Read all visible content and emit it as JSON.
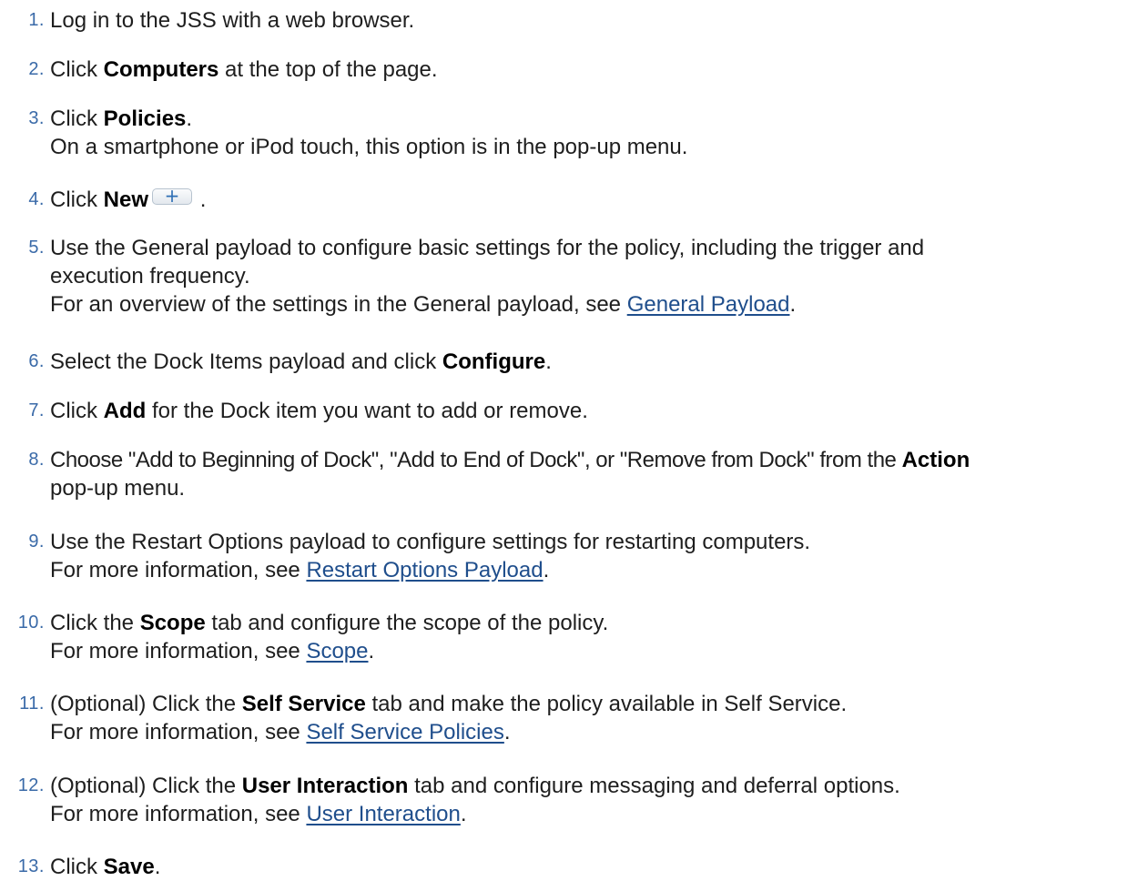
{
  "steps": [
    {
      "n": "1.",
      "pre": "Log in to the JSS with a web browser."
    },
    {
      "n": "2.",
      "pre": "Click ",
      "bold": "Computers",
      "post": " at the top of the page."
    },
    {
      "n": "3.",
      "pre": "Click ",
      "bold": "Policies",
      "post": ".",
      "note": "On a smartphone or iPod touch, this option is in the pop-up menu."
    },
    {
      "n": "4.",
      "pre": "Click ",
      "bold": "New",
      "post": " .",
      "button_icon": "plus-icon",
      "button_glyph": "+"
    },
    {
      "n": "5.",
      "pre": "Use the General payload to configure basic settings for the policy, including the trigger and",
      "pre2": "execution frequency.",
      "note_pre": "For an overview of the settings in the General payload, see ",
      "link": "General Payload",
      "note_post": "."
    },
    {
      "n": "6.",
      "pre": "Select the Dock Items payload and click ",
      "bold": "Configure",
      "post": "."
    },
    {
      "n": "7.",
      "pre": "Click ",
      "bold": "Add",
      "post": " for the Dock item you want to add or remove."
    },
    {
      "n": "8.",
      "pre": "Choose \"Add to Beginning of Dock\", \"Add to End of Dock\", or \"Remove from Dock\" from the ",
      "bold": "Action",
      "pre2": "pop-up menu."
    },
    {
      "n": "9.",
      "pre": "Use the Restart Options payload to configure settings for restarting computers.",
      "note_pre": "For more information, see ",
      "link": "Restart Options Payload",
      "note_post": "."
    },
    {
      "n": "10.",
      "pre": "Click the ",
      "bold": "Scope",
      "post": " tab and configure the scope of the policy.",
      "note_pre": "For more information, see ",
      "link": "Scope",
      "note_post": "."
    },
    {
      "n": "11.",
      "pre": "(Optional) Click the ",
      "bold": "Self Service",
      "post": " tab and make the policy available in Self Service.",
      "note_pre": "For more information, see ",
      "link": "Self Service Policies",
      "note_post": "."
    },
    {
      "n": "12.",
      "pre": "(Optional) Click the ",
      "bold": "User Interaction",
      "post": " tab and configure messaging and deferral options.",
      "note_pre": "For more information, see ",
      "link": "User Interaction",
      "note_post": "."
    },
    {
      "n": "13.",
      "pre": "Click ",
      "bold": "Save",
      "post": "."
    }
  ],
  "colors": {
    "number": "#3a6aa8",
    "link": "#1f4e8c",
    "text": "#1e1e1e"
  }
}
